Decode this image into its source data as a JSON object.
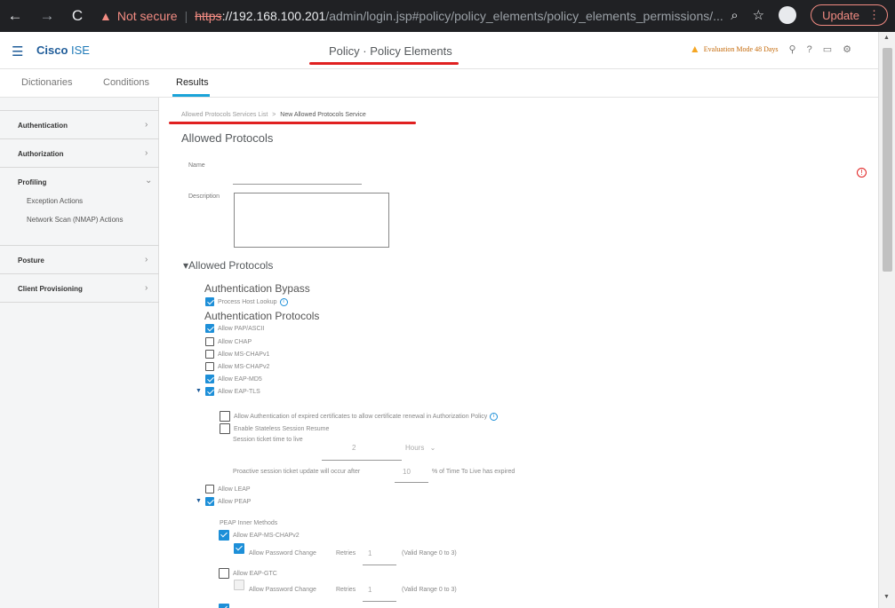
{
  "browser": {
    "not_secure": "Not secure",
    "url_scheme": "https",
    "url_host": "://192.168.100.201",
    "url_path": "/admin/login.jsp#policy/policy_elements/policy_elements_permissions/...",
    "update_label": "Update"
  },
  "header": {
    "brand_bold": "Cisco",
    "brand_rest": " ISE",
    "title": "Policy · Policy Elements",
    "evaluation": "Evaluation Mode 48 Days"
  },
  "tabs": [
    {
      "label": "Dictionaries"
    },
    {
      "label": "Conditions"
    },
    {
      "label": "Results",
      "active": true
    }
  ],
  "sidebar": {
    "items": [
      {
        "label": "Authentication"
      },
      {
        "label": "Authorization"
      },
      {
        "label": "Profiling",
        "expanded": true
      },
      {
        "label": "Posture"
      },
      {
        "label": "Client Provisioning"
      }
    ],
    "profiling_children": [
      "Exception Actions",
      "Network Scan (NMAP) Actions"
    ]
  },
  "breadcrumb": {
    "parent": "Allowed Protocols Services List",
    "separator": ">",
    "current": "New Allowed Protocols Service"
  },
  "form": {
    "heading": "Allowed Protocols",
    "name_label": "Name",
    "description_label": "Description",
    "section_title": "Allowed Protocols",
    "bypass_heading": "Authentication Bypass",
    "process_host_lookup": "Process Host Lookup",
    "protocols_heading": "Authentication Protocols",
    "protocols": [
      {
        "label": "Allow PAP/ASCII",
        "checked": true
      },
      {
        "label": "Allow CHAP",
        "checked": false
      },
      {
        "label": "Allow MS-CHAPv1",
        "checked": false
      },
      {
        "label": "Allow MS-CHAPv2",
        "checked": false
      },
      {
        "label": "Allow EAP-MD5",
        "checked": true
      },
      {
        "label": "Allow EAP-TLS",
        "checked": true
      }
    ],
    "eap_tls": {
      "expired_certs": "Allow Authentication of expired certificates to allow certificate renewal in Authorization Policy",
      "stateless_resume": "Enable Stateless Session Resume",
      "ticket_ttl_label": "Session ticket time to live",
      "ticket_ttl_value": "2",
      "ticket_ttl_unit": "Hours",
      "proactive_prefix": "Proactive session ticket update will occur after",
      "proactive_value": "10",
      "proactive_suffix": "% of Time To Live has expired"
    },
    "allow_leap": "Allow LEAP",
    "allow_peap": "Allow PEAP",
    "peap": {
      "inner_heading": "PEAP Inner Methods",
      "mschapv2": "Allow EAP-MS-CHAPv2",
      "pwd_change": "Allow Password Change",
      "retries_label": "Retries",
      "retries_value": "1",
      "range": "(Valid Range 0 to 3)",
      "gtc": "Allow EAP-GTC"
    }
  }
}
